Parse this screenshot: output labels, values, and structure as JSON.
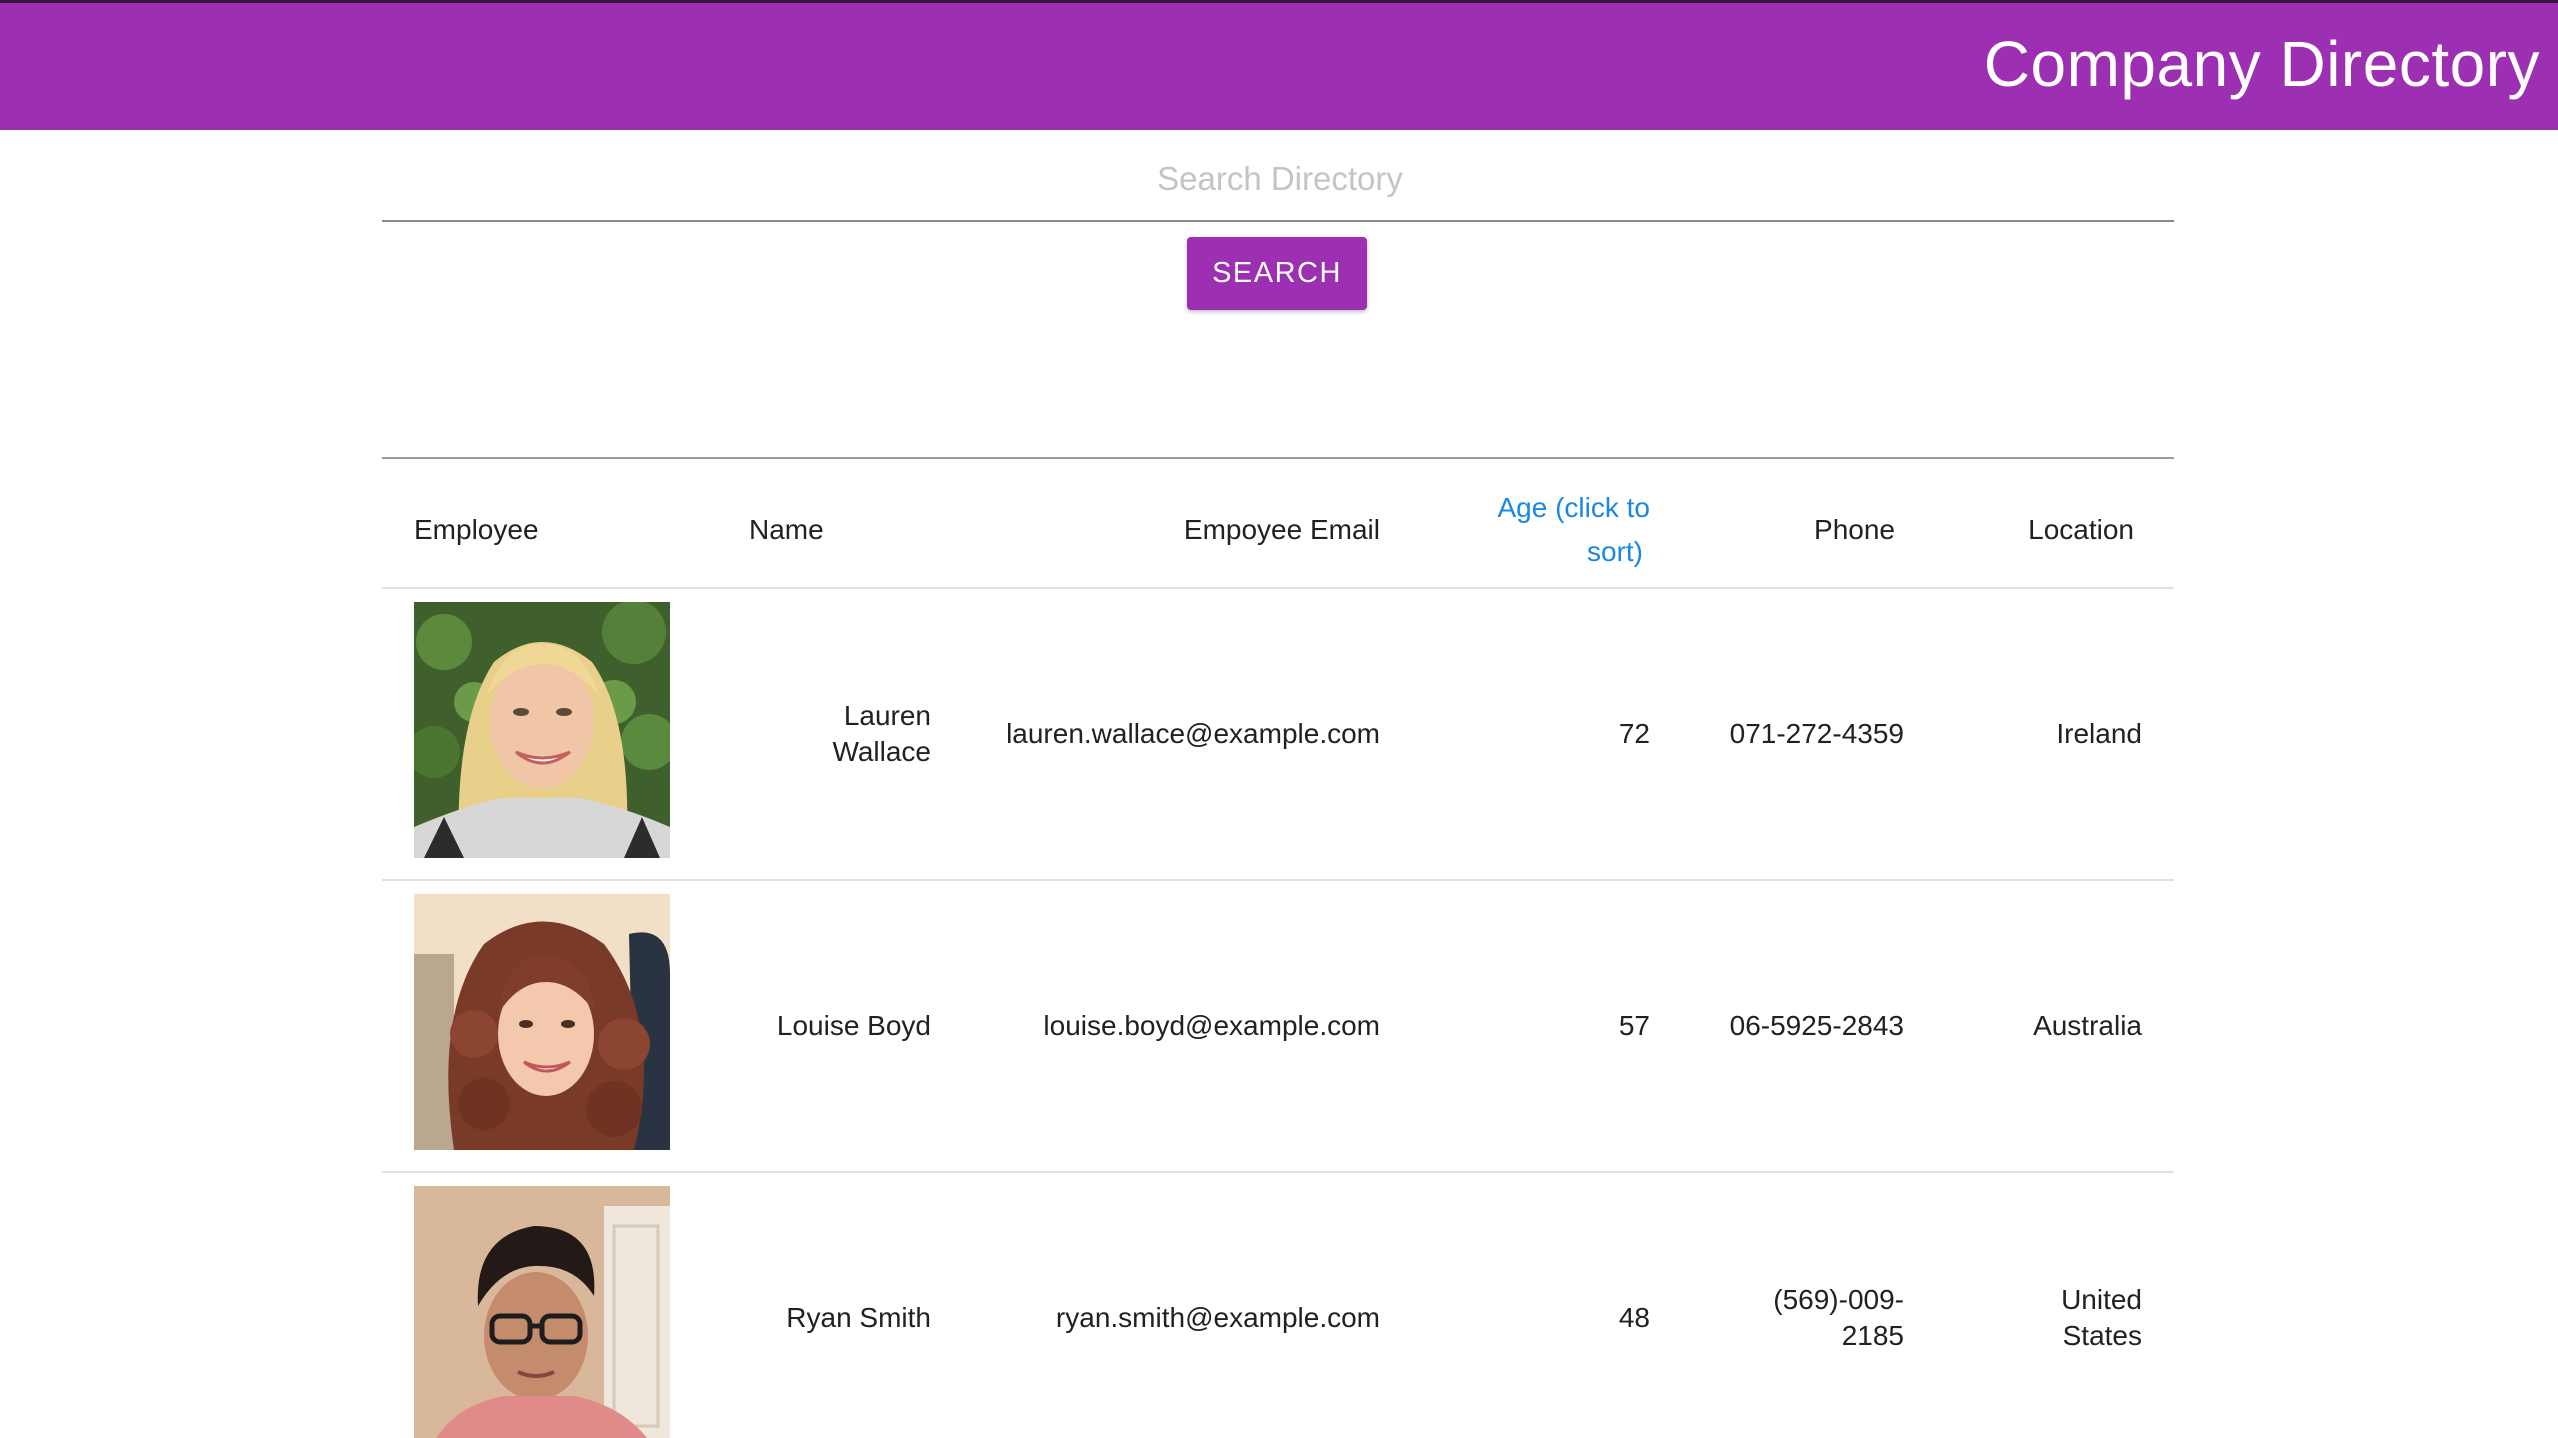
{
  "header": {
    "title": "Company Directory",
    "color": "#9c2fb2"
  },
  "search": {
    "placeholder": "Search Directory",
    "value": "",
    "button_label": "SEARCH"
  },
  "table": {
    "columns": [
      "Employee",
      "Name",
      "Empoyee Email",
      "Age (click to sort)",
      "Phone",
      "Location"
    ],
    "sort_label_line1": "Age (click to",
    "sort_label_line2": "sort)",
    "rows": [
      {
        "avatar": "portrait-photo-blonde-woman",
        "name_line1": "Lauren",
        "name_line2": "Wallace",
        "email": "lauren.wallace@example.com",
        "age": "72",
        "phone_line1": "071-272-4359",
        "phone_line2": "",
        "location_line1": "Ireland",
        "location_line2": ""
      },
      {
        "avatar": "portrait-photo-curly-haired-woman",
        "name_line1": "Louise Boyd",
        "name_line2": "",
        "email": "louise.boyd@example.com",
        "age": "57",
        "phone_line1": "06-5925-2843",
        "phone_line2": "",
        "location_line1": "Australia",
        "location_line2": ""
      },
      {
        "avatar": "portrait-photo-man-with-glasses",
        "name_line1": "Ryan Smith",
        "name_line2": "",
        "email": "ryan.smith@example.com",
        "age": "48",
        "phone_line1": "(569)-009-",
        "phone_line2": "2185",
        "location_line1": "United",
        "location_line2": "States"
      }
    ]
  },
  "colors": {
    "accent": "#9c2fb2",
    "link": "#1a88e0"
  }
}
